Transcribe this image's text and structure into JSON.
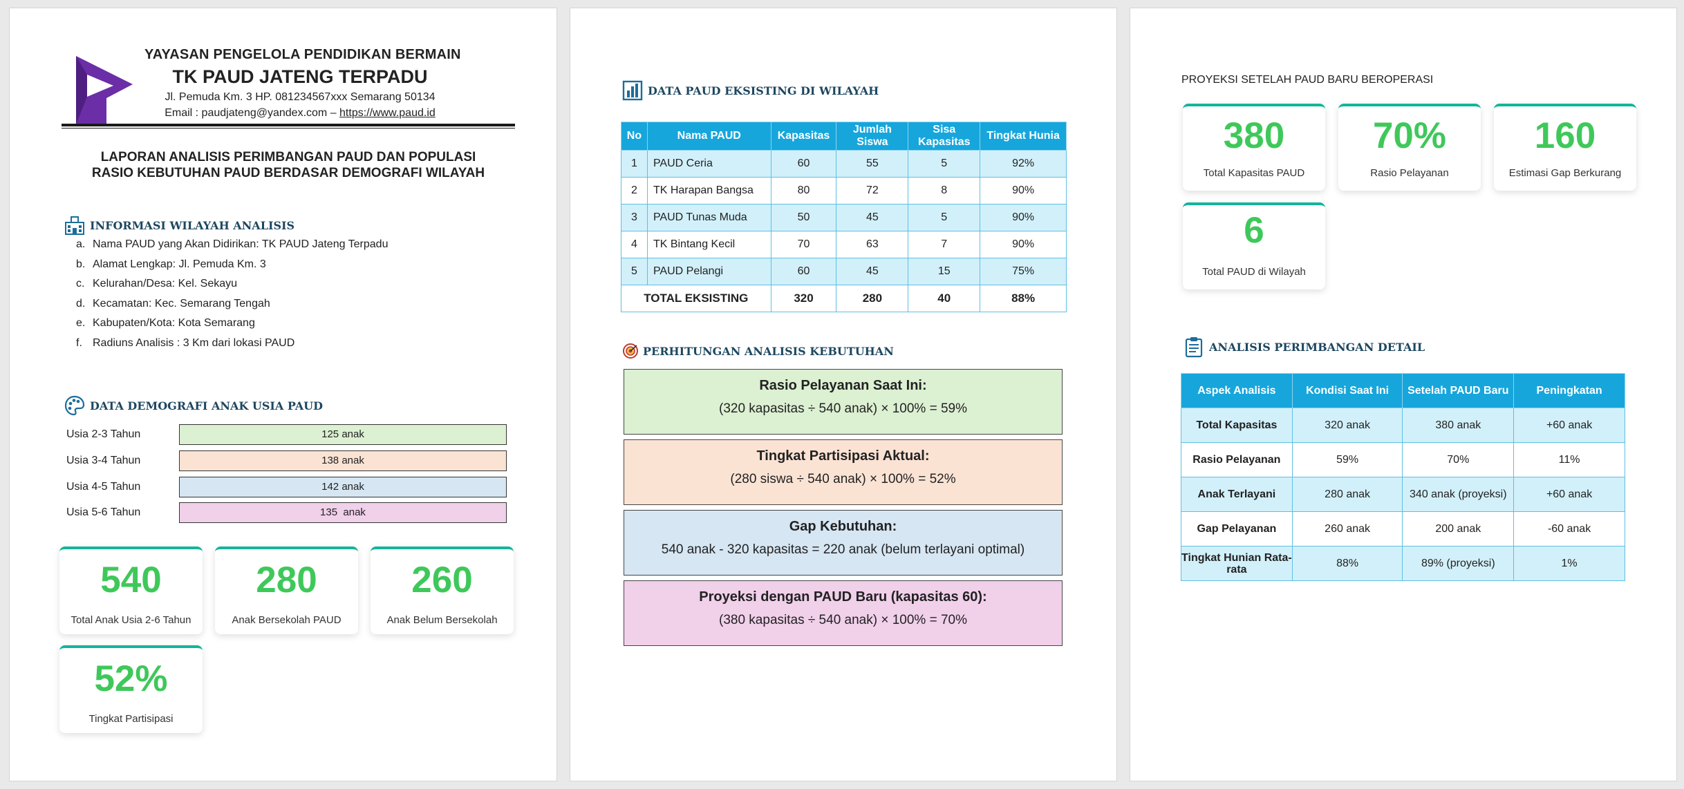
{
  "header": {
    "org": "YAYASAN PENGELOLA PENDIDIKAN BERMAIN",
    "school": "TK PAUD JATENG TERPADU",
    "address": "Jl. Pemuda Km. 3 HP. 081234567xxx Semarang 50134",
    "contact_prefix": "Email : paudjateng@yandex.com – ",
    "website": "https://www.paud.id",
    "report_title_1": "LAPORAN ANALISIS PERIMBANGAN PAUD DAN POPULASI",
    "report_title_2": "RASIO KEBUTUHAN PAUD BERDASAR DEMOGRAFI WILAYAH"
  },
  "info": {
    "title": "INFORMASI WILAYAH ANALISIS",
    "items": [
      {
        "key": "a.",
        "text": "Nama PAUD yang Akan Didirikan: TK PAUD Jateng Terpadu"
      },
      {
        "key": "b.",
        "text": "Alamat Lengkap: Jl. Pemuda Km. 3"
      },
      {
        "key": "c.",
        "text": "Kelurahan/Desa: Kel. Sekayu"
      },
      {
        "key": "d.",
        "text": "Kecamatan: Kec. Semarang Tengah"
      },
      {
        "key": "e.",
        "text": "Kabupaten/Kota: Kota Semarang"
      },
      {
        "key": "f.",
        "text": "Radiuns Analisis : 3 Km dari lokasi PAUD"
      }
    ]
  },
  "demografi": {
    "title": "DATA DEMOGRAFI ANAK USIA PAUD",
    "rows": [
      {
        "label": "Usia 2-3 Tahun",
        "value": "125 anak",
        "color": "#dcf0d2"
      },
      {
        "label": "Usia 3-4 Tahun",
        "value": "138 anak",
        "color": "#fbe3d4"
      },
      {
        "label": "Usia 4-5 Tahun",
        "value": "142 anak",
        "color": "#d6e6f3"
      },
      {
        "label": "Usia 5-6 Tahun",
        "value": "135  anak",
        "color": "#f1d0ea"
      }
    ]
  },
  "cards_page1": [
    {
      "value": "540",
      "label": "Total Anak Usia 2-6 Tahun"
    },
    {
      "value": "280",
      "label": "Anak Bersekolah PAUD"
    },
    {
      "value": "260",
      "label": "Anak Belum Bersekolah"
    },
    {
      "value": "52%",
      "label": "Tingkat Partisipasi"
    }
  ],
  "eksisting": {
    "title": "DATA PAUD EKSISTING DI WILAYAH",
    "headers": [
      "No",
      "Nama PAUD",
      "Kapasitas",
      "Jumlah Siswa",
      "Sisa Kapasitas",
      "Tingkat Hunia"
    ],
    "rows": [
      [
        "1",
        "PAUD Ceria",
        "60",
        "55",
        "5",
        "92%"
      ],
      [
        "2",
        "TK Harapan Bangsa",
        "80",
        "72",
        "8",
        "90%"
      ],
      [
        "3",
        "PAUD Tunas Muda",
        "50",
        "45",
        "5",
        "90%"
      ],
      [
        "4",
        "TK Bintang Kecil",
        "70",
        "63",
        "7",
        "90%"
      ],
      [
        "5",
        "PAUD Pelangi",
        "60",
        "45",
        "15",
        "75%"
      ]
    ],
    "total": [
      "TOTAL EKSISTING",
      "320",
      "280",
      "40",
      "88%"
    ]
  },
  "perhitungan": {
    "title": "PERHITUNGAN ANALISIS KEBUTUHAN",
    "boxes": [
      {
        "title": "Rasio Pelayanan Saat Ini:",
        "formula": "(320 kapasitas ÷ 540 anak) × 100% = 59%",
        "color": "#dcf0d2"
      },
      {
        "title": "Tingkat Partisipasi Aktual:",
        "formula": "(280 siswa ÷ 540 anak) × 100% = 52%",
        "color": "#fbe3d4"
      },
      {
        "title": "Gap Kebutuhan:",
        "formula": "540 anak - 320 kapasitas = 220 anak (belum terlayani optimal)",
        "color": "#d6e6f3"
      },
      {
        "title": "Proyeksi dengan PAUD Baru (kapasitas 60):",
        "formula": "(380 kapasitas ÷ 540 anak) × 100% = 70%",
        "color": "#f1d0ea"
      }
    ]
  },
  "proyeksi": {
    "title": "PROYEKSI SETELAH PAUD BARU BEROPERASI",
    "cards": [
      {
        "value": "380",
        "label": "Total Kapasitas PAUD"
      },
      {
        "value": "70%",
        "label": "Rasio Pelayanan"
      },
      {
        "value": "160",
        "label": "Estimasi Gap Berkurang"
      },
      {
        "value": "6",
        "label": "Total PAUD di Wilayah"
      }
    ]
  },
  "perimbangan": {
    "title": "ANALISIS PERIMBANGAN DETAIL",
    "headers": [
      "Aspek Analisis",
      "Kondisi Saat Ini",
      "Setelah PAUD Baru",
      "Peningkatan"
    ],
    "rows": [
      [
        "Total Kapasitas",
        "320 anak",
        "380 anak",
        "+60 anak"
      ],
      [
        "Rasio Pelayanan",
        "59%",
        "70%",
        "11%"
      ],
      [
        "Anak Terlayani",
        "280 anak",
        "340 anak (proyeksi)",
        "+60 anak"
      ],
      [
        "Gap Pelayanan",
        "260 anak",
        "200 anak",
        "-60 anak"
      ],
      [
        "Tingkat Hunian Rata-rata",
        "88%",
        "89% (proyeksi)",
        "1%"
      ]
    ]
  },
  "colors": {
    "accent_green": "#3fc85a",
    "card_border": "#13b59a",
    "table_header": "#16a6dc",
    "logo": "#6b2ea6",
    "section_title": "#1d4760"
  }
}
